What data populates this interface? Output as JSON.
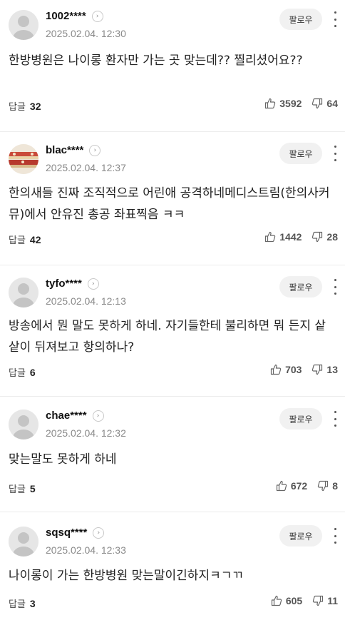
{
  "ui": {
    "reply_label": "답글",
    "follow_label": "팔로우"
  },
  "comments": [
    {
      "nick": "1002****",
      "date": "2025.02.04. 12:30",
      "text": "한방병원은 나이롱 환자만 가는 곳 맞는데?? 찔리셨어요??",
      "reply_count": "32",
      "likes": "3592",
      "dislikes": "64"
    },
    {
      "nick": "blac****",
      "date": "2025.02.04. 12:37",
      "text": "한의새들 진짜 조직적으로 어린애 공격하네메디스트림(한의사커뮤)에서 안유진 총공 좌표찍음 ㅋㅋ",
      "reply_count": "42",
      "likes": "1442",
      "dislikes": "28"
    },
    {
      "nick": "tyfo****",
      "date": "2025.02.04. 12:13",
      "text": "방송에서 뭔 말도 못하게 하네. 자기들한테 불리하면 뭐 든지 샅샅이 뒤져보고 항의하나?",
      "reply_count": "6",
      "likes": "703",
      "dislikes": "13"
    },
    {
      "nick": "chae****",
      "date": "2025.02.04. 12:32",
      "text": "맞는말도 못하게 하네",
      "reply_count": "5",
      "likes": "672",
      "dislikes": "8"
    },
    {
      "nick": "sqsq****",
      "date": "2025.02.04. 12:33",
      "text": "나이롱이 가는 한방병원 맞는말이긴하지ㅋㄱㄲ",
      "reply_count": "3",
      "likes": "605",
      "dislikes": "11"
    }
  ]
}
